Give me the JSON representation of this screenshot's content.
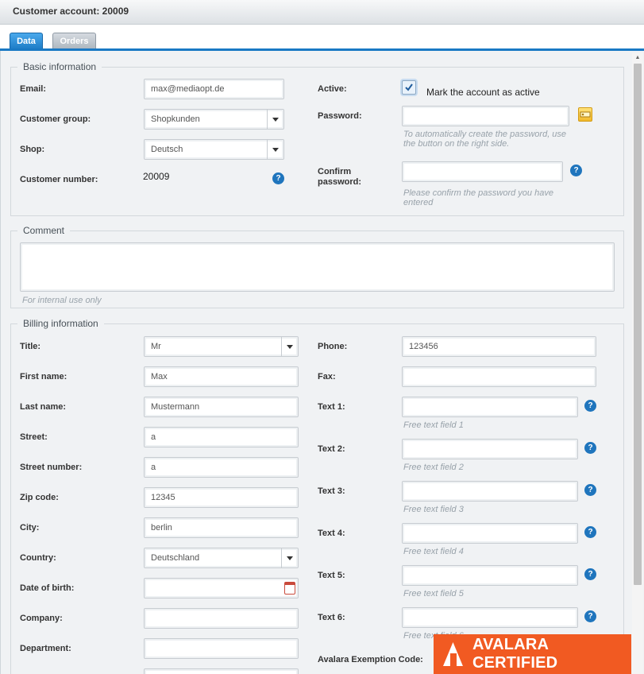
{
  "window": {
    "title": "Customer account: 20009"
  },
  "tabs": [
    {
      "label": "Data"
    },
    {
      "label": "Orders"
    }
  ],
  "basic": {
    "legend": "Basic information",
    "email_label": "Email:",
    "email_value": "max@mediaopt.de",
    "group_label": "Customer group:",
    "group_value": "Shopkunden",
    "shop_label": "Shop:",
    "shop_value": "Deutsch",
    "number_label": "Customer number:",
    "number_value": "20009",
    "active_label": "Active:",
    "active_text": "Mark the account as active",
    "active_checked": true,
    "password_label": "Password:",
    "password_value": "",
    "password_hint": "To automatically create the password, use the button on the right side.",
    "confirm_label": "Confirm password:",
    "confirm_value": "",
    "confirm_hint": "Please confirm the password you have entered"
  },
  "comment": {
    "legend": "Comment",
    "value": "",
    "hint": "For internal use only"
  },
  "billing": {
    "legend": "Billing information",
    "title_label": "Title:",
    "title_value": "Mr",
    "first_label": "First name:",
    "first_value": "Max",
    "last_label": "Last name:",
    "last_value": "Mustermann",
    "street_label": "Street:",
    "street_value": "a",
    "streetnum_label": "Street number:",
    "streetnum_value": "a",
    "zip_label": "Zip code:",
    "zip_value": "12345",
    "city_label": "City:",
    "city_value": "berlin",
    "country_label": "Country:",
    "country_value": "Deutschland",
    "dob_label": "Date of birth:",
    "dob_value": "",
    "company_label": "Company:",
    "company_value": "",
    "department_label": "Department:",
    "department_value": "",
    "phone_label": "Phone:",
    "phone_value": "123456",
    "fax_label": "Fax:",
    "fax_value": "",
    "text1_label": "Text 1:",
    "text1_hint": "Free text field 1",
    "text2_label": "Text 2:",
    "text2_hint": "Free text field 2",
    "text3_label": "Text 3:",
    "text3_hint": "Free text field 3",
    "text4_label": "Text 4:",
    "text4_hint": "Free text field 4",
    "text5_label": "Text 5:",
    "text5_hint": "Free text field 5",
    "text6_label": "Text 6:",
    "text6_hint": "Free text field 6",
    "avalara_label": "Avalara Exemption Code:"
  },
  "help_symbol": "?",
  "badge": {
    "text": "AVALARA CERTIFIED",
    "color": "#f15a22"
  },
  "colors": {
    "accent": "#1a79c4",
    "help": "#1f75bd"
  }
}
